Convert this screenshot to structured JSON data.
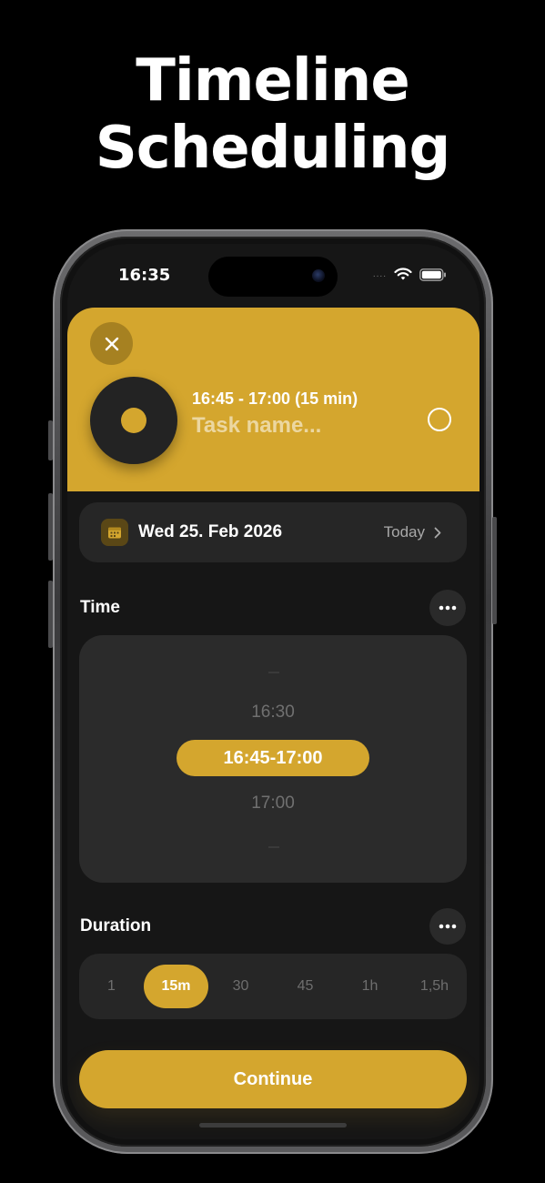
{
  "headline": {
    "line1": "Timeline",
    "line2": "Scheduling"
  },
  "status_bar": {
    "time": "16:35",
    "signal": "....",
    "icons": [
      "wifi-icon",
      "battery-icon"
    ]
  },
  "task": {
    "time_range": "16:45 - 17:00 (15 min)",
    "name_placeholder": "Task name...",
    "color": "#d4a62e",
    "close_icon": "close-icon",
    "complete_icon": "circle-outline-icon"
  },
  "date_row": {
    "icon": "calendar-icon",
    "date": "Wed 25. Feb 2026",
    "today_label": "Today",
    "chevron": "›"
  },
  "time_section": {
    "title": "Time",
    "more_icon": "ellipsis-icon",
    "options": [
      "16:30",
      "16:45-17:00",
      "17:00"
    ],
    "selected": "16:45-17:00"
  },
  "duration_section": {
    "title": "Duration",
    "more_icon": "ellipsis-icon",
    "options": [
      "1",
      "15m",
      "30",
      "45",
      "1h",
      "1,5h"
    ],
    "selected": "15m"
  },
  "continue_label": "Continue",
  "colors": {
    "accent": "#d4a62e",
    "background": "#161616",
    "card": "#262626"
  }
}
